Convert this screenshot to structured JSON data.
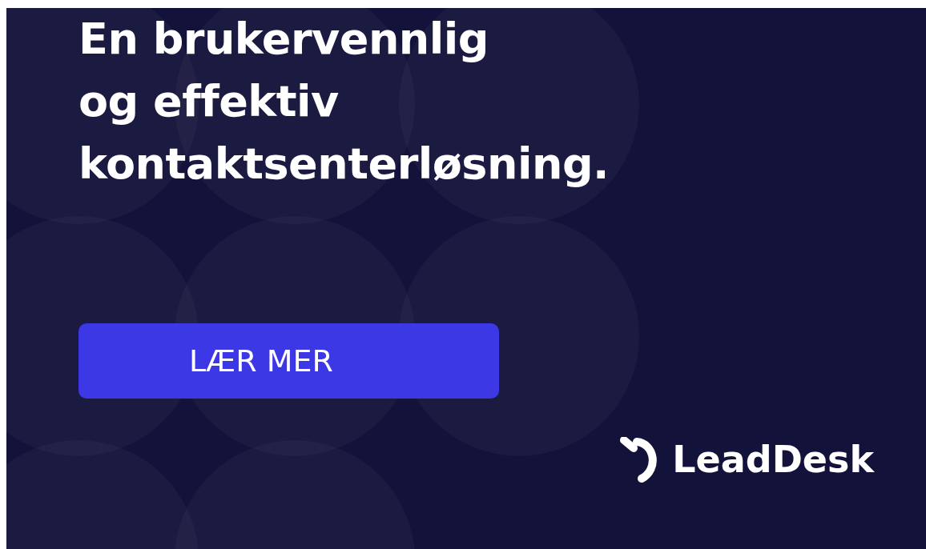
{
  "headline": [
    "En brukervennlig",
    "og effektiv",
    "kontaktsenterløsning."
  ],
  "cta_button": {
    "label": "LÆR MER"
  },
  "brand": {
    "name": "LeadDesk"
  }
}
